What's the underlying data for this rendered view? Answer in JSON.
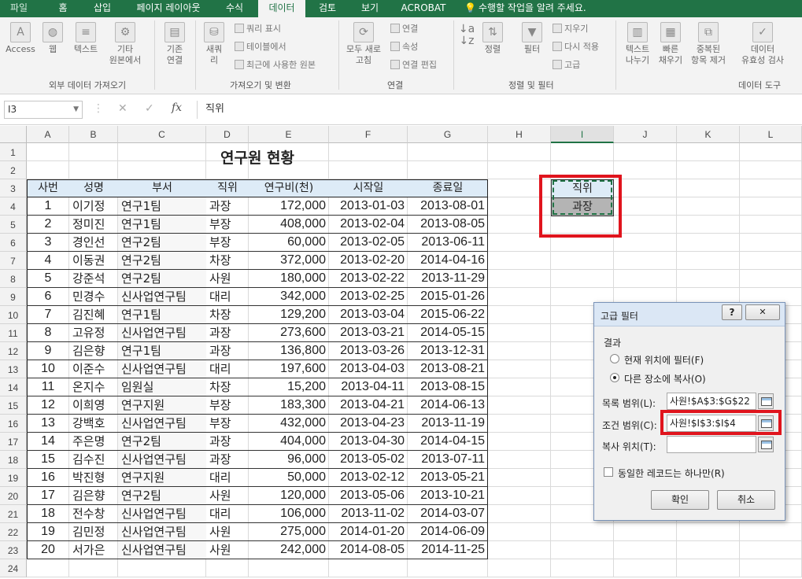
{
  "ribbon_tabs": [
    "파일",
    "홈",
    "삽입",
    "페이지 레이아웃",
    "수식",
    "데이터",
    "검토",
    "보기",
    "ACROBAT",
    "수행할 작업을 알려 주세요."
  ],
  "ribbon": {
    "access": "Access",
    "web": "웹",
    "text": "텍스트",
    "other1": "기타",
    "other2": "원본에서",
    "existing1": "기존",
    "existing2": "연결",
    "new1": "새쿼",
    "new2": "리",
    "query_show": "쿼리 표시",
    "from_table": "테이블에서",
    "recent_sources": "최근에 사용한 원본",
    "refresh_all1": "모두 새로",
    "refresh_all2": "고침",
    "connections": "연결",
    "properties": "속성",
    "edit_links": "연결 편집",
    "sort": "정렬",
    "filter": "필터",
    "clear": "지우기",
    "reapply": "다시 적용",
    "advanced": "고급",
    "text_to_columns1": "텍스트",
    "text_to_columns2": "나누기",
    "flash_fill1": "빠른",
    "flash_fill2": "채우기",
    "remove_dup1": "중복된",
    "remove_dup2": "항목 제거",
    "validation1": "데이터",
    "validation2": "유효성 검사",
    "group_external": "외부 데이터 가져오기",
    "group_transform": "가져오기 및 변환",
    "group_connections": "연결",
    "group_sortfilter": "정렬 및 필터",
    "group_datatools": "데이터 도구"
  },
  "formula_bar": {
    "name_box": "I3",
    "content": "직위"
  },
  "columns": [
    "A",
    "B",
    "C",
    "D",
    "E",
    "F",
    "G",
    "H",
    "I",
    "J",
    "K",
    "L"
  ],
  "rows": [
    "1",
    "2",
    "3",
    "4",
    "5",
    "6",
    "7",
    "8",
    "9",
    "10",
    "11",
    "12",
    "13",
    "14",
    "15",
    "16",
    "17",
    "18",
    "19",
    "20",
    "21",
    "22",
    "23",
    "24"
  ],
  "sheet": {
    "title": "연구원 현황",
    "headers": [
      "사번",
      "성명",
      "부서",
      "직위",
      "연구비(천)",
      "시작일",
      "종료일"
    ],
    "records": [
      [
        "1",
        "이기정",
        "연구1팀",
        "과장",
        "172,000",
        "2013-01-03",
        "2013-08-01"
      ],
      [
        "2",
        "정미진",
        "연구1팀",
        "부장",
        "408,000",
        "2013-02-04",
        "2013-08-05"
      ],
      [
        "3",
        "경인선",
        "연구2팀",
        "부장",
        "60,000",
        "2013-02-05",
        "2013-06-11"
      ],
      [
        "4",
        "이동권",
        "연구2팀",
        "차장",
        "372,000",
        "2013-02-20",
        "2014-04-16"
      ],
      [
        "5",
        "강준석",
        "연구2팀",
        "사원",
        "180,000",
        "2013-02-22",
        "2013-11-29"
      ],
      [
        "6",
        "민경수",
        "신사업연구팀",
        "대리",
        "342,000",
        "2013-02-25",
        "2015-01-26"
      ],
      [
        "7",
        "김진혜",
        "연구1팀",
        "차장",
        "129,200",
        "2013-03-04",
        "2015-06-22"
      ],
      [
        "8",
        "고유정",
        "신사업연구팀",
        "과장",
        "273,600",
        "2013-03-21",
        "2014-05-15"
      ],
      [
        "9",
        "김은향",
        "연구1팀",
        "과장",
        "136,800",
        "2013-03-26",
        "2013-12-31"
      ],
      [
        "10",
        "이준수",
        "신사업연구팀",
        "대리",
        "197,600",
        "2013-04-03",
        "2013-08-21"
      ],
      [
        "11",
        "온지수",
        "임원실",
        "차장",
        "15,200",
        "2013-04-11",
        "2013-08-15"
      ],
      [
        "12",
        "이희영",
        "연구지원",
        "부장",
        "183,300",
        "2013-04-21",
        "2014-06-13"
      ],
      [
        "13",
        "강백호",
        "신사업연구팀",
        "부장",
        "432,000",
        "2013-04-23",
        "2013-11-19"
      ],
      [
        "14",
        "주은명",
        "연구2팀",
        "과장",
        "404,000",
        "2013-04-30",
        "2014-04-15"
      ],
      [
        "15",
        "김수진",
        "신사업연구팀",
        "과장",
        "96,000",
        "2013-05-02",
        "2013-07-11"
      ],
      [
        "16",
        "박진형",
        "연구지원",
        "대리",
        "50,000",
        "2013-02-12",
        "2013-05-21"
      ],
      [
        "17",
        "김은향",
        "연구2팀",
        "사원",
        "120,000",
        "2013-05-06",
        "2013-10-21"
      ],
      [
        "18",
        "전수창",
        "신사업연구팀",
        "대리",
        "106,000",
        "2013-11-02",
        "2014-03-07"
      ],
      [
        "19",
        "김민정",
        "신사업연구팀",
        "사원",
        "275,000",
        "2014-01-20",
        "2014-06-09"
      ],
      [
        "20",
        "서가은",
        "신사업연구팀",
        "사원",
        "242,000",
        "2014-08-05",
        "2014-11-25"
      ]
    ],
    "criteria_header": "직위",
    "criteria_value": "과장"
  },
  "dialog": {
    "title": "고급 필터",
    "help": "?",
    "close": "✕",
    "result_label": "결과",
    "option_inplace": "현재 위치에 필터(F)",
    "option_copy": "다른 장소에 복사(O)",
    "list_range_label": "목록 범위(L):",
    "list_range_value": "사원!$A$3:$G$22",
    "criteria_range_label": "조건 범위(C):",
    "criteria_range_value": "사원!$I$3:$I$4",
    "copy_to_label": "복사 위치(T):",
    "copy_to_value": "",
    "unique_label": "동일한 레코드는 하나만(R)",
    "ok": "확인",
    "cancel": "취소"
  },
  "colors": {
    "excel_green": "#217346",
    "header_fill": "#ddebf7",
    "criteria_fill": "#b4b4b4",
    "highlight_red": "#e0141d"
  }
}
